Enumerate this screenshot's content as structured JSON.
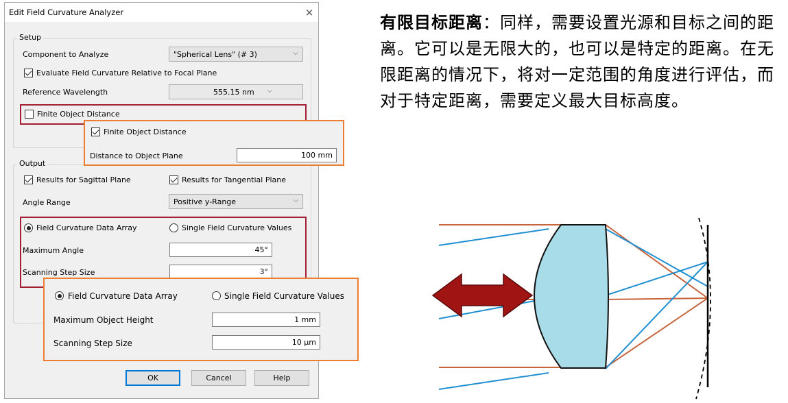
{
  "dialog": {
    "title": "Edit Field Curvature Analyzer",
    "close_glyph": "×",
    "setup": {
      "legend": "Setup",
      "component_label": "Component to Analyze",
      "component_value": "\"Spherical Lens\" (# 3)",
      "evaluate_label": "Evaluate Field Curvature Relative to Focal Plane",
      "evaluate_checked": true,
      "wavelength_label": "Reference Wavelength",
      "wavelength_value": "555.15 nm",
      "finite_label": "Finite Object Distance",
      "finite_checked": false
    },
    "finite_popup": {
      "checkbox_label": "Finite Object Distance",
      "checked": true,
      "distance_label": "Distance to Object Plane",
      "distance_value": "100 mm"
    },
    "output": {
      "legend": "Output",
      "sagittal_label": "Results for Sagittal Plane",
      "sagittal_checked": true,
      "tangential_label": "Results for Tangential Plane",
      "tangential_checked": true,
      "angle_range_label": "Angle Range",
      "angle_range_value": "Positive y-Range",
      "radio_array_label": "Field Curvature Data Array",
      "radio_single_label": "Single Field Curvature Values",
      "max_angle_label": "Maximum Angle",
      "max_angle_value": "45°",
      "step_label": "Scanning Step Size",
      "step_value": "3°"
    },
    "object_popup": {
      "radio_array_label": "Field Curvature Data Array",
      "radio_single_label": "Single Field Curvature Values",
      "max_height_label": "Maximum Object Height",
      "max_height_value": "1 mm",
      "step_label": "Scanning Step Size",
      "step_value": "10 µm"
    },
    "buttons": {
      "ok": "OK",
      "cancel": "Cancel",
      "help": "Help"
    }
  },
  "description": {
    "term": "有限目标距离",
    "text": "：同样，需要设置光源和目标之间的距离。它可以是无限大的，也可以是特定的距离。在无限距离的情况下，将对一定范围的角度进行评估，而对于特定距离，需要定义最大目标高度。"
  },
  "colors": {
    "red_highlight": "#a31f34",
    "orange_highlight": "#ed7d31",
    "ray_orange": "#c8643c",
    "ray_blue": "#1f8fd1",
    "lens_fill": "#a8dce8",
    "arrow_fill": "#a01414"
  }
}
